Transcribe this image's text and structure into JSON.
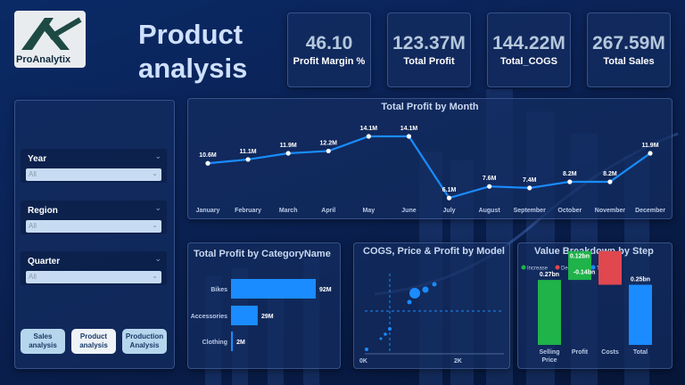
{
  "logo": {
    "text": "ProAnalytix"
  },
  "page_title": "Product analysis",
  "kpis": [
    {
      "value": "46.10",
      "label": "Profit Margin %"
    },
    {
      "value": "123.37M",
      "label": "Total Profit"
    },
    {
      "value": "144.22M",
      "label": "Total_COGS"
    },
    {
      "value": "267.59M",
      "label": "Total Sales"
    }
  ],
  "slicers": [
    {
      "label": "Year",
      "value": "All"
    },
    {
      "label": "Region",
      "value": "All"
    },
    {
      "label": "Quarter",
      "value": "All"
    }
  ],
  "nav": {
    "sales": "Sales analysis",
    "product": "Product analysis",
    "production": "Production Analysis"
  },
  "chart_data": [
    {
      "type": "line",
      "title": "Total Profit by Month",
      "categories": [
        "January",
        "February",
        "March",
        "April",
        "May",
        "June",
        "July",
        "August",
        "September",
        "October",
        "November",
        "December"
      ],
      "values": [
        10.6,
        11.1,
        11.9,
        12.2,
        14.1,
        14.1,
        6.1,
        7.6,
        7.4,
        8.2,
        8.2,
        11.9
      ],
      "labels": [
        "10.6M",
        "11.1M",
        "11.9M",
        "12.2M",
        "14.1M",
        "14.1M",
        "6.1M",
        "7.6M",
        "7.4M",
        "8.2M",
        "8.2M",
        "11.9M"
      ],
      "unit": "M"
    },
    {
      "type": "bar",
      "title": "Total Profit by CategoryName",
      "categories": [
        "Bikes",
        "Accessories",
        "Clothing"
      ],
      "values": [
        92,
        29,
        2
      ],
      "labels": [
        "92M",
        "29M",
        "2M"
      ]
    },
    {
      "type": "scatter",
      "title": "COGS, Price & Profit by Model",
      "x_ticks": [
        "0K",
        "2K"
      ]
    },
    {
      "type": "bar",
      "title": "Value Breakdown by Step",
      "legend": [
        "Increase",
        "Decrease",
        "Total"
      ],
      "categories": [
        "Selling Price",
        "Profit",
        "Costs",
        "Total"
      ],
      "values": [
        0.27,
        0.12,
        -0.14,
        0.25
      ],
      "labels": [
        "0.27bn",
        "0.12bn",
        "-0.14bn",
        "0.25bn"
      ],
      "colors": {
        "increase": "#1fb34a",
        "decrease": "#e0474f",
        "total": "#1a8cff"
      }
    }
  ]
}
